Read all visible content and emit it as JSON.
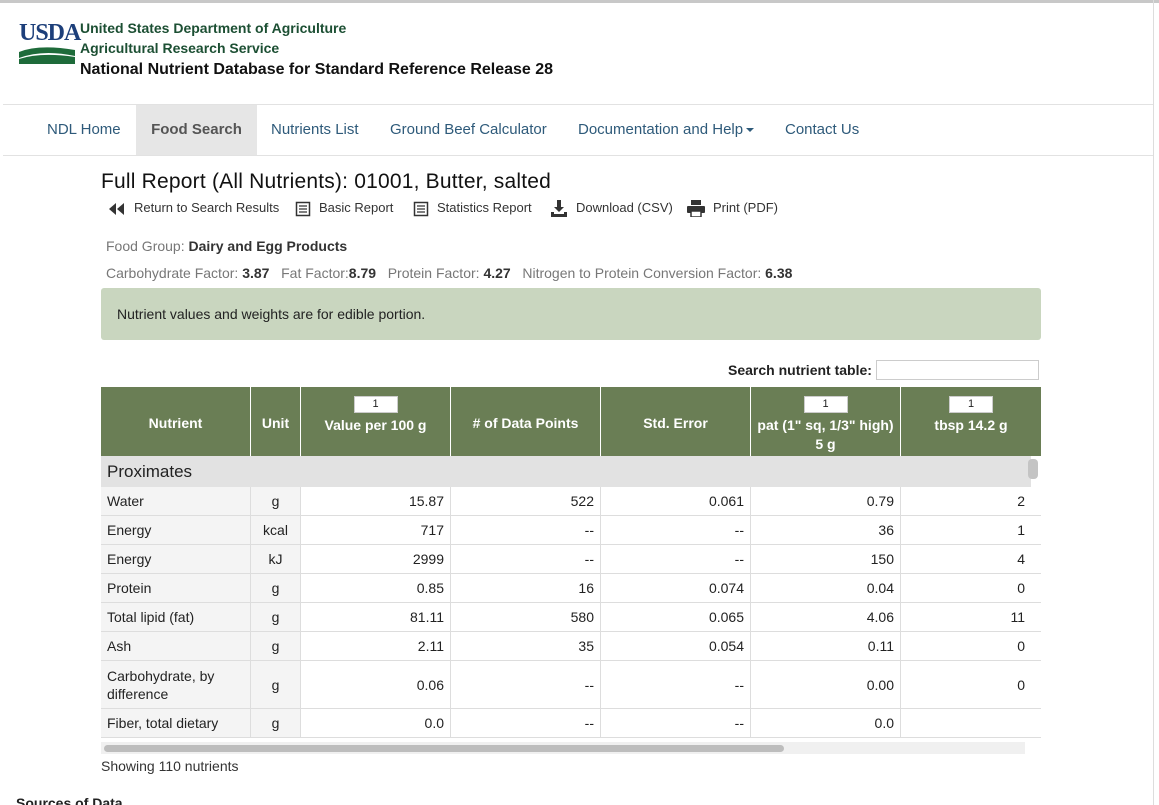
{
  "header": {
    "logo_text": "USDA",
    "line1": "United States Department of Agriculture",
    "line2": "Agricultural Research Service",
    "line3": "National Nutrient Database for Standard Reference Release 28"
  },
  "nav": {
    "items": [
      {
        "label": "NDL Home"
      },
      {
        "label": "Food Search"
      },
      {
        "label": "Nutrients List"
      },
      {
        "label": "Ground Beef Calculator"
      },
      {
        "label": "Documentation and Help"
      },
      {
        "label": "Contact Us"
      }
    ],
    "active": "Food Search"
  },
  "report": {
    "title": "Full Report (All Nutrients):  01001, Butter, salted",
    "actions": {
      "return": "Return to Search Results",
      "basic": "Basic Report",
      "statistics": "Statistics Report",
      "download": "Download (CSV)",
      "print": "Print (PDF)"
    },
    "food_group_label": "Food Group:",
    "food_group_value": "Dairy and Egg Products",
    "factors": {
      "carb_label": "Carbohydrate Factor:",
      "carb_value": "3.87",
      "fat_label": "Fat Factor:",
      "fat_value": "8.79",
      "protein_label": "Protein Factor:",
      "protein_value": "4.27",
      "nitrogen_label": "Nitrogen to Protein Conversion Factor:",
      "nitrogen_value": "6.38"
    },
    "notice": "Nutrient values and weights are for edible portion."
  },
  "table": {
    "search_label": "Search nutrient table:",
    "search_value": "",
    "headers": {
      "nutrient": "Nutrient",
      "unit": "Unit",
      "value": "Value per 100 g",
      "points": "# of Data Points",
      "stderr": "Std. Error",
      "pat_line1": "pat (1\" sq, 1/3\" high)",
      "pat_line2": "5 g",
      "tbsp": "tbsp 14.2 g"
    },
    "multipliers": {
      "value": "1",
      "pat": "1",
      "tbsp": "1"
    },
    "group": "Proximates",
    "rows": [
      {
        "name": "Water",
        "unit": "g",
        "value": "15.87",
        "points": "522",
        "stderr": "0.061",
        "pat": "0.79",
        "tbsp": "2"
      },
      {
        "name": "Energy",
        "unit": "kcal",
        "value": "717",
        "points": "--",
        "stderr": "--",
        "pat": "36",
        "tbsp": "1"
      },
      {
        "name": "Energy",
        "unit": "kJ",
        "value": "2999",
        "points": "--",
        "stderr": "--",
        "pat": "150",
        "tbsp": "4"
      },
      {
        "name": "Protein",
        "unit": "g",
        "value": "0.85",
        "points": "16",
        "stderr": "0.074",
        "pat": "0.04",
        "tbsp": "0"
      },
      {
        "name": "Total lipid (fat)",
        "unit": "g",
        "value": "81.11",
        "points": "580",
        "stderr": "0.065",
        "pat": "4.06",
        "tbsp": "11"
      },
      {
        "name": "Ash",
        "unit": "g",
        "value": "2.11",
        "points": "35",
        "stderr": "0.054",
        "pat": "0.11",
        "tbsp": "0"
      },
      {
        "name": "Carbohydrate, by difference",
        "unit": "g",
        "value": "0.06",
        "points": "--",
        "stderr": "--",
        "pat": "0.00",
        "tbsp": "0"
      },
      {
        "name": "Fiber, total dietary",
        "unit": "g",
        "value": "0.0",
        "points": "--",
        "stderr": "--",
        "pat": "0.0",
        "tbsp": ""
      }
    ],
    "showing": "Showing 110 nutrients"
  },
  "footer": {
    "sources_heading": "Sources of Data"
  },
  "colors": {
    "table_header": "#6a7e55",
    "notice_bg": "#c9d6bf",
    "nav_active_bg": "#e6e6e6",
    "title_green": "#1c4f33",
    "link_blue": "#2e5a7a"
  }
}
